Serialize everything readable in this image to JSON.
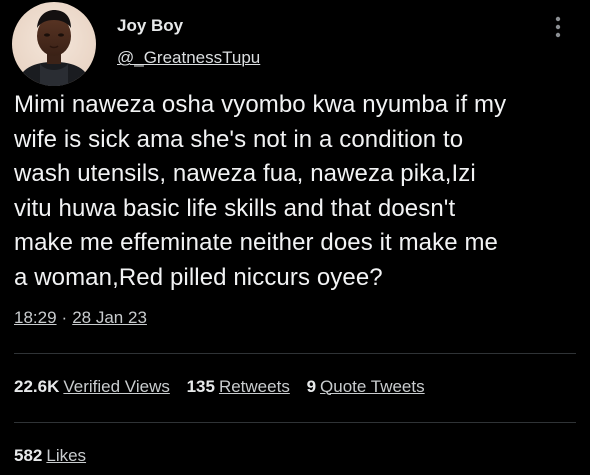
{
  "tweet": {
    "display_name": "Joy Boy",
    "handle": "@_GreatnessTupu",
    "text": "Mimi naweza osha vyombo kwa nyumba if my\nwife is sick ama she's not in a condition to\nwash utensils, naweza fua, naweza pika,Izi\nvitu huwa basic life skills and that doesn't\nmake me effeminate neither does it make me\na woman,Red pilled niccurs oyee?",
    "time": "18:29",
    "separator": "·",
    "date": "28 Jan 23"
  },
  "stats": {
    "views_count": "22.6K",
    "views_label": "Verified Views",
    "retweets_count": "135",
    "retweets_label": "Retweets",
    "quotes_count": "9",
    "quotes_label": "Quote Tweets",
    "likes_count": "582",
    "likes_label": "Likes"
  },
  "icons": {
    "more": "more-vertical-icon",
    "avatar": "profile-avatar"
  },
  "colors": {
    "background": "#000000",
    "text": "#e7e9ea",
    "secondary_text": "#c9ccce",
    "divider": "#2f3336"
  }
}
